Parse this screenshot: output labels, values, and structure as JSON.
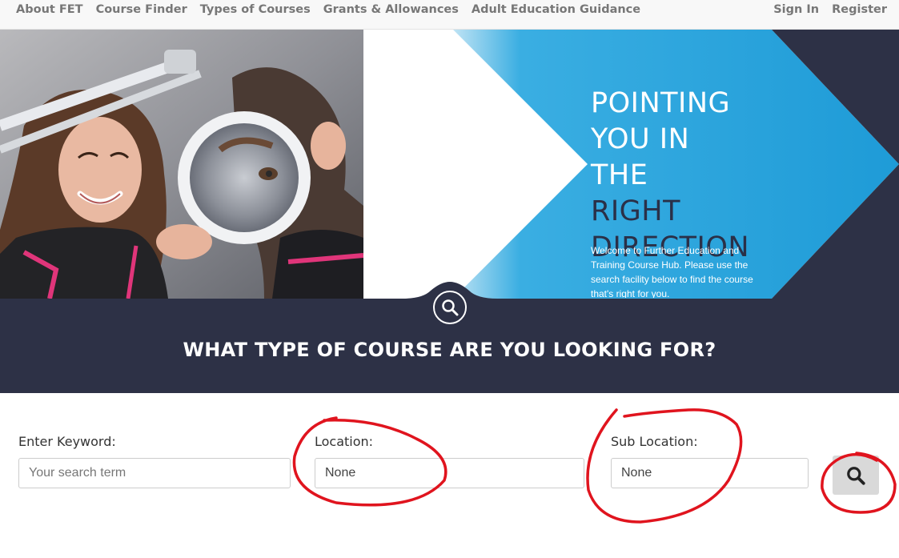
{
  "nav": {
    "left": [
      {
        "label": "About FET"
      },
      {
        "label": "Course Finder"
      },
      {
        "label": "Types of Courses"
      },
      {
        "label": "Grants & Allowances"
      },
      {
        "label": "Adult Education Guidance"
      }
    ],
    "right": [
      {
        "label": "Sign In"
      },
      {
        "label": "Register"
      }
    ]
  },
  "hero": {
    "headline_light": [
      "POINTING",
      "YOU IN",
      "THE"
    ],
    "headline_dark": [
      "RIGHT",
      "DIRECTION"
    ],
    "welcome": "Welcome to Further Education and Training Course Hub. Please use the search facility below to find the course that's right for you."
  },
  "band": {
    "title": "WHAT TYPE OF COURSE ARE YOU LOOKING FOR?"
  },
  "search": {
    "keyword_label": "Enter Keyword:",
    "keyword_placeholder": "Your search term",
    "location_label": "Location:",
    "location_value": "None",
    "sublocation_label": "Sub Location:",
    "sublocation_value": "None"
  },
  "colors": {
    "nav_text": "#777777",
    "accent_blue": "#1e9bd7",
    "dark_navy": "#2d3146",
    "annotation_red": "#e0141e"
  }
}
